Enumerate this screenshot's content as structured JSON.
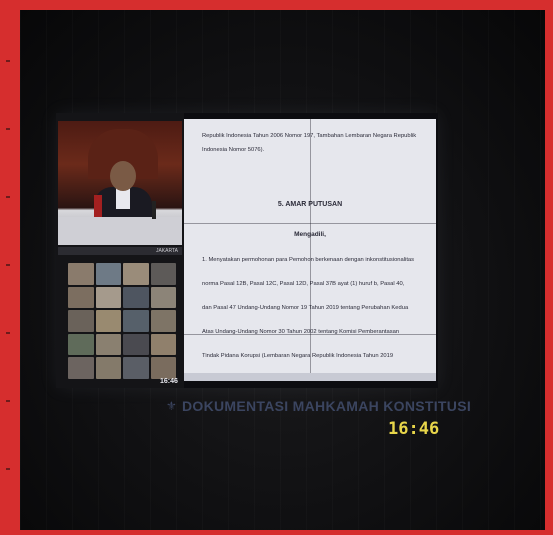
{
  "scene": {
    "frame_color": "#d62e2e",
    "screen_doc": {
      "lines": [
        "Republik Indonesia Tahun 2006 Nomor 197, Tambahan Lembaran Negara Republik",
        "Indonesia Nomor 5076).",
        "5. AMAR PUTUSAN",
        "Mengadili,",
        "1.  Menyatakan permohonan para Pemohon berkenaan dengan inkonstitusionalitas",
        "norma Pasal 12B, Pasal 12C, Pasal 12D, Pasal 37B ayat (1) huruf b, Pasal 40,",
        "dan Pasal 47 Undang-Undang Nomor 19 Tahun 2019 tentang Perubahan Kedua",
        "Atas Undang-Undang Nomor 30 Tahun 2002 tentang Komisi Pemberantasan",
        "Tindak Pidana Korupsi (Lembaran Negara Republik Indonesia Tahun 2019"
      ]
    },
    "panel_label": "JAKARTA",
    "small_timestamp": "16:46",
    "watermark": "DOKUMENTASI MAHKAMAH KONSTITUSI",
    "big_timestamp": "16:46"
  }
}
